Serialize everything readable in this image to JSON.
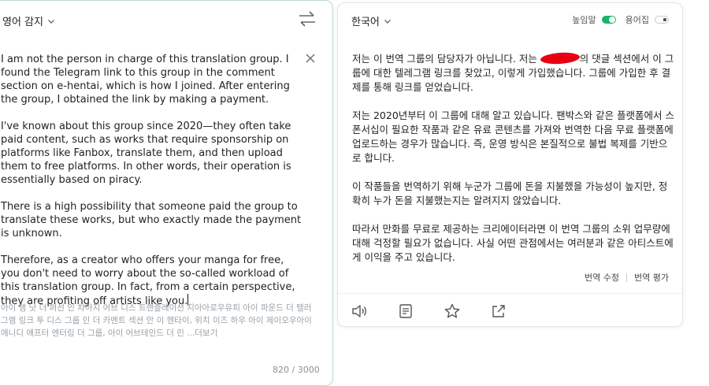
{
  "source": {
    "language": "영어 감지",
    "paragraphs": [
      "I am not the person in charge of this translation group. I found the Telegram link to this group in the comment section on e-hentai, which is how I joined. After entering the group, I obtained the link by making a payment.",
      "I've known about this group since 2020—they often take paid content, such as works that require sponsorship on platforms like Fanbox, translate them, and then upload them to free platforms. In other words, their operation is essentially based on piracy.",
      "There is a high possibility that someone paid the group to translate these works, but who exactly made the payment is unknown.",
      "Therefore, as a creator who offers your manga for free, you don't need to worry about the so-called workload of this translation group. In fact, from a certain perspective, they are profiting off artists like you."
    ],
    "pronunciation": "아이 앰 낫 더 퍼선 인 차아지 어브 디스 트랜즐레이션 지아아로우유피 아이 파운드 더 텔러그램 링크 투 디스 그룹 인 더 카멘트 섹션 안 이 헨타이, 위치 이즈 하우 아이 제이오우아이에니디 애프터 엔터링 더 그룹, 아이 어브테인드 더 린 ...",
    "more_label": "더보기",
    "char_count": "820 / 3000"
  },
  "target": {
    "language": "한국어",
    "honorific_label": "높임말",
    "honorific_on": true,
    "glossary_label": "용어집",
    "glossary_on": false,
    "paragraph1_before": "저는 이 번역 그룹의 담당자가 아닙니다. 저는 ",
    "paragraph1_after": "의 댓글 섹션에서 이 그룹에 대한 텔레그램 링크를 찾았고, 이렇게 가입했습니다. 그룹에 가입한 후 결제를 통해 링크를 얻었습니다.",
    "paragraphs": [
      "저는 2020년부터 이 그룹에 대해 알고 있습니다. 팬박스와 같은 플랫폼에서 스폰서십이 필요한 작품과 같은 유료 콘텐츠를 가져와 번역한 다음 무료 플랫폼에 업로드하는 경우가 많습니다. 즉, 운영 방식은 본질적으로 불법 복제를 기반으로 합니다.",
      "이 작품들을 번역하기 위해 누군가 그룹에 돈을 지불했을 가능성이 높지만, 정확히 누가 돈을 지불했는지는 알려지지 않았습니다.",
      "따라서 만화를 무료로 제공하는 크리에이터라면 이 번역 그룹의 소위 업무량에 대해 걱정할 필요가 없습니다. 사실 어떤 관점에서는 여러분과 같은 아티스트에게 이익을 주고 있습니다."
    ],
    "edit_label": "번역 수정",
    "rate_label": "번역 평가"
  },
  "icons": {
    "chevron": "chevron-down-icon",
    "swap": "swap-arrows-icon",
    "clear": "close-icon",
    "speaker": "speaker-icon",
    "copy": "copy-icon",
    "star": "star-icon",
    "share": "share-icon"
  },
  "colors": {
    "accent": "#19b46a",
    "source_border": "#b9dfc7",
    "redaction": "#e60012"
  }
}
